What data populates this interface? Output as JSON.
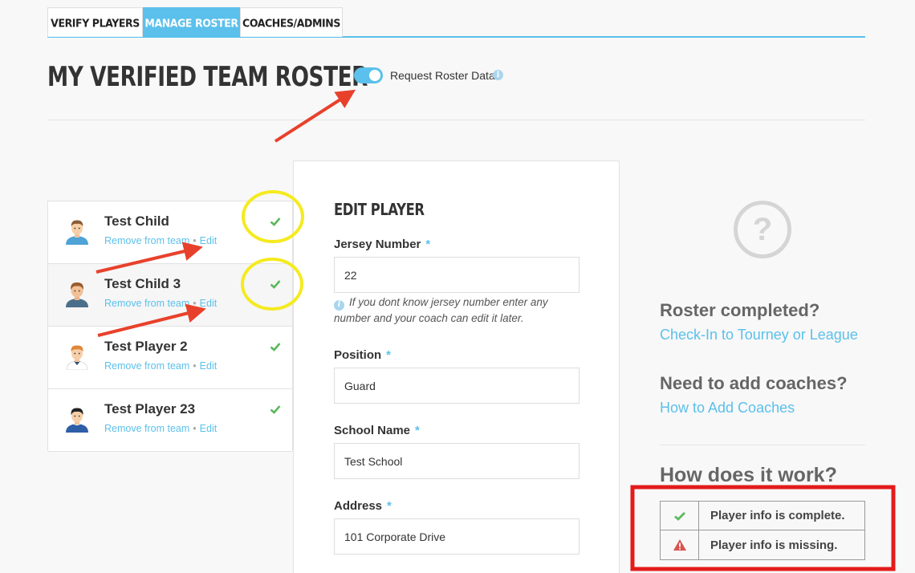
{
  "tabs": [
    {
      "label": "VERIFY PLAYERS",
      "active": false
    },
    {
      "label": "MANAGE ROSTER",
      "active": true
    },
    {
      "label": "COACHES/ADMINS",
      "active": false
    }
  ],
  "page_title": "MY VERIFIED TEAM ROSTER",
  "request_toggle": {
    "label": "Request Roster Data",
    "on": true
  },
  "players": [
    {
      "name": "Test Child",
      "remove_label": "Remove from team",
      "edit_label": "Edit",
      "status": "complete"
    },
    {
      "name": "Test Child 3",
      "remove_label": "Remove from team",
      "edit_label": "Edit",
      "status": "complete"
    },
    {
      "name": "Test Player 2",
      "remove_label": "Remove from team",
      "edit_label": "Edit",
      "status": "complete"
    },
    {
      "name": "Test Player 23",
      "remove_label": "Remove from team",
      "edit_label": "Edit",
      "status": "complete"
    }
  ],
  "edit_form": {
    "title": "EDIT PLAYER",
    "jersey": {
      "label": "Jersey Number",
      "required": "*",
      "value": "22"
    },
    "jersey_hint": "If you dont know jersey number enter any number and your coach can edit it later.",
    "position": {
      "label": "Position",
      "required": "*",
      "value": "Guard"
    },
    "school": {
      "label": "School Name",
      "required": "*",
      "value": "Test School"
    },
    "address": {
      "label": "Address",
      "required": "*",
      "value": "101 Corporate Drive"
    }
  },
  "sidebar": {
    "help_icon": "question-circle-icon",
    "roster_heading": "Roster completed?",
    "roster_link": "Check-In to Tourney or League",
    "coaches_heading": "Need to add coaches?",
    "coaches_link": "How to Add Coaches",
    "how_heading": "How does it work?",
    "legend": [
      {
        "icon": "check-icon",
        "text": "Player info is complete."
      },
      {
        "icon": "warning-icon",
        "text": "Player info is missing."
      }
    ]
  },
  "colors": {
    "accent": "#5bc0eb",
    "check": "#5cb85c",
    "warning": "#d9534f",
    "annotation_arrow": "#e8412b",
    "annotation_circle": "#f5ea1f",
    "annotation_box": "#e31b1b"
  }
}
